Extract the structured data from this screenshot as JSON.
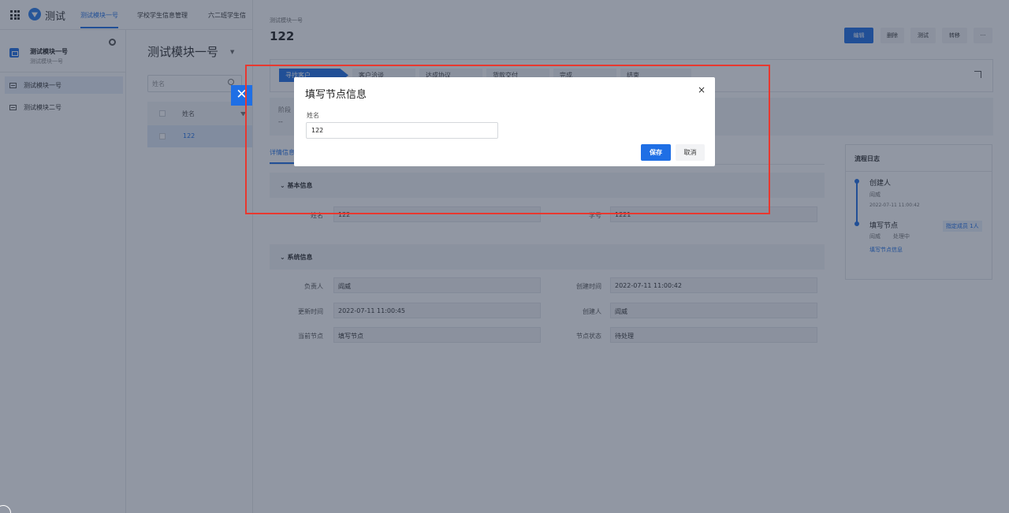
{
  "header": {
    "app_title": "测试",
    "tabs": [
      "测试模块一号",
      "学校学生信息管理",
      "六二班学生信"
    ]
  },
  "sidebar": {
    "module_title": "测试模块一号",
    "module_subtitle": "测试模块一号",
    "items": [
      "测试模块一号",
      "测试模块二号"
    ]
  },
  "list": {
    "title": "测试模块一号",
    "search_placeholder": "姓名",
    "column_header": "姓名",
    "rows": [
      "122"
    ]
  },
  "detail": {
    "breadcrumb": "测试模块一号",
    "record_title": "122",
    "actions": [
      "编辑",
      "删除",
      "测试",
      "转移",
      "···"
    ],
    "stages": [
      "寻找客户",
      "客户洽谈",
      "达成协议",
      "货款交付",
      "完成",
      "结束"
    ],
    "phase_label": "阶段",
    "phase_value": "--",
    "tab": "详情信息",
    "sections": {
      "basic": {
        "title": "基本信息",
        "fields": [
          {
            "label": "姓名",
            "value": "122"
          },
          {
            "label": "学号",
            "value": "1221"
          }
        ]
      },
      "system": {
        "title": "系统信息",
        "fields": [
          {
            "label": "负责人",
            "value": "阎威"
          },
          {
            "label": "创建时间",
            "value": "2022-07-11 11:00:42"
          },
          {
            "label": "更新时间",
            "value": "2022-07-11 11:00:45"
          },
          {
            "label": "创建人",
            "value": "阎威"
          },
          {
            "label": "当前节点",
            "value": "填写节点"
          },
          {
            "label": "节点状态",
            "value": "待处理"
          }
        ]
      }
    }
  },
  "log": {
    "title": "流程日志",
    "entries": [
      {
        "title": "创建人",
        "person": "阎威",
        "time": "2022-07-11 11:00:42"
      },
      {
        "title": "填写节点",
        "person": "阎威",
        "status": "处理中",
        "badge": "指定成员 1人",
        "link": "填写节点信息"
      }
    ]
  },
  "modal": {
    "title": "填写节点信息",
    "close": "×",
    "field_label": "姓名",
    "field_value": "122",
    "save": "保存",
    "cancel": "取消"
  },
  "colors": {
    "accent": "#1f6fe5",
    "highlight": "#e8382f"
  }
}
